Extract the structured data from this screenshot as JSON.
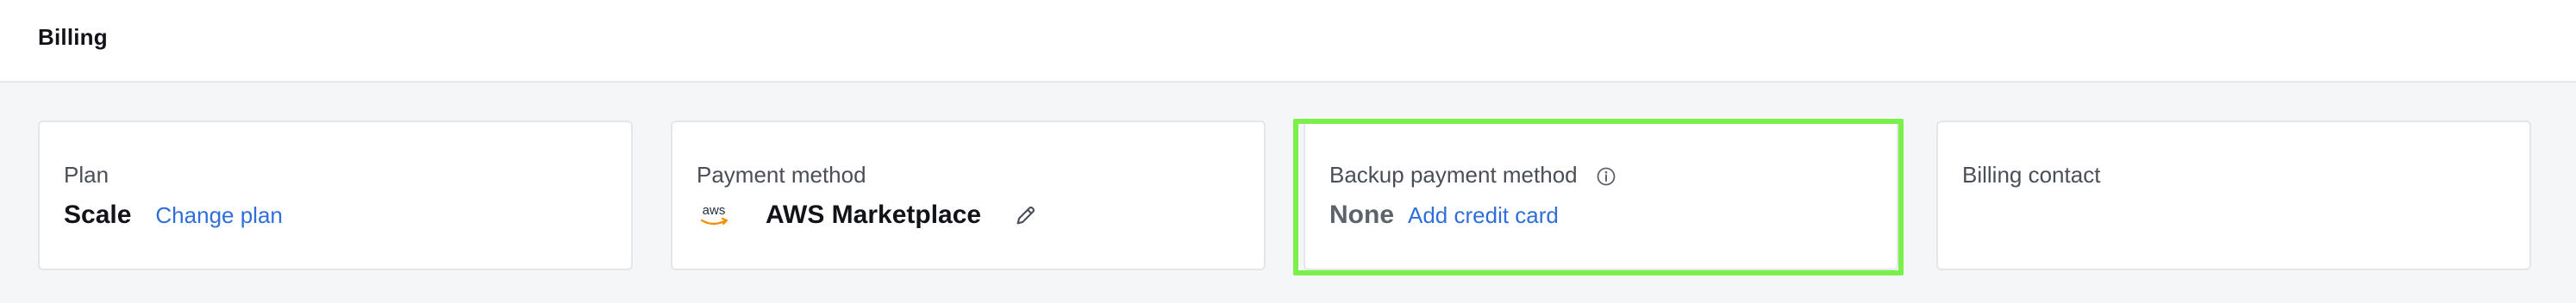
{
  "header": {
    "title": "Billing"
  },
  "cards": {
    "plan": {
      "label": "Plan",
      "value": "Scale",
      "action": "Change plan"
    },
    "payment": {
      "label": "Payment method",
      "logo_text": "aws",
      "value": "AWS Marketplace",
      "edit_icon": "pencil-icon"
    },
    "backup": {
      "label": "Backup payment method",
      "info_icon": "info-icon",
      "value": "None",
      "action": "Add credit card"
    },
    "contact": {
      "label": "Billing contact"
    }
  },
  "colors": {
    "accent_link": "#2f6fdb",
    "highlight": "#7cf04a"
  }
}
